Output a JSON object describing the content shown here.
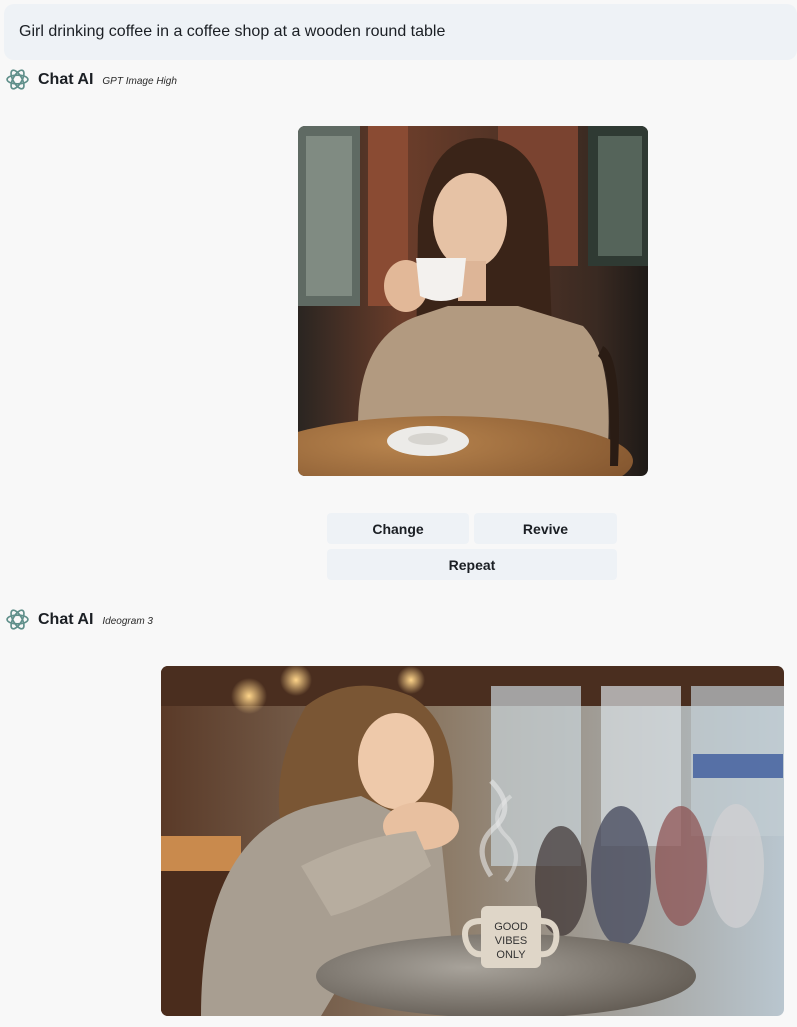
{
  "prompt": {
    "text": "Girl drinking coffee in a coffee shop at a wooden round table"
  },
  "responses": [
    {
      "assistant_name": "Chat AI",
      "model": "GPT Image High",
      "actions": {
        "change": "Change",
        "revive": "Revive",
        "repeat": "Repeat"
      }
    },
    {
      "assistant_name": "Chat AI",
      "model": "Ideogram 3",
      "mug_text": [
        "GOOD",
        "VIBES",
        "ONLY"
      ]
    }
  ],
  "colors": {
    "bubble": "#eef2f6",
    "logo": "#5f8f8a",
    "page": "#f8f8f8"
  }
}
